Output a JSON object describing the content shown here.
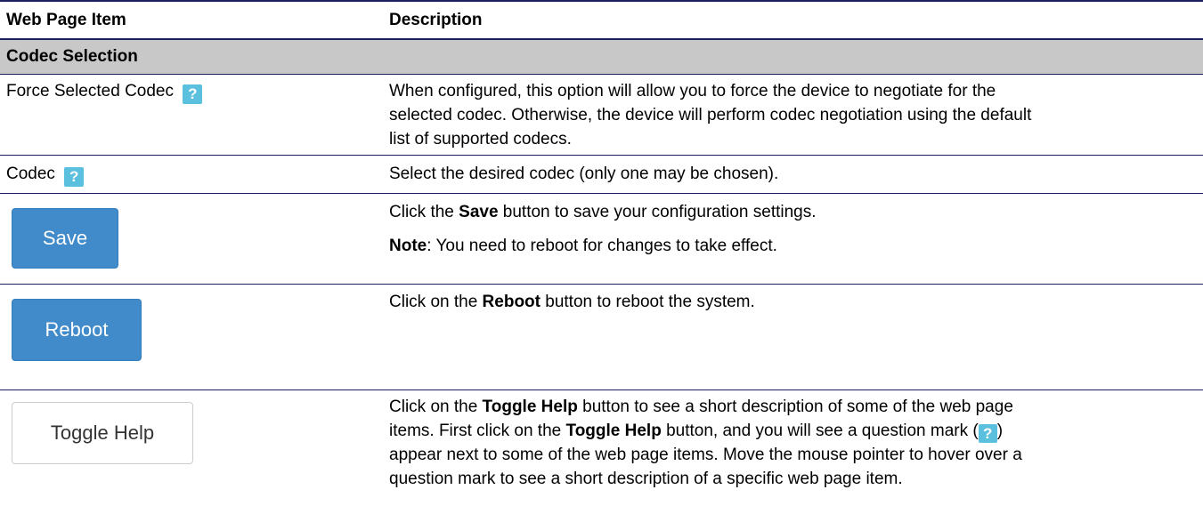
{
  "header": {
    "col1": "Web Page Item",
    "col2": "Description"
  },
  "section": {
    "title": "Codec Selection"
  },
  "help_icon_glyph": "?",
  "rows": {
    "force": {
      "label": "Force Selected Codec",
      "desc_line1": "When configured, this option will allow you to force the device to negotiate for the",
      "desc_line2": "selected codec. Otherwise, the device will perform codec negotiation using the default",
      "desc_line3": "list of supported codecs."
    },
    "codec": {
      "label": "Codec",
      "desc": "Select the desired codec (only one may be chosen)."
    },
    "save": {
      "button_label": "Save",
      "desc_pre": "Click the ",
      "desc_bold": "Save",
      "desc_post": " button to save your configuration settings.",
      "note_bold": "Note",
      "note_text": ": You need to reboot for changes to take effect."
    },
    "reboot": {
      "button_label": "Reboot",
      "desc_pre": "Click on the ",
      "desc_bold": "Reboot",
      "desc_post": " button to reboot the system."
    },
    "toggle": {
      "button_label": "Toggle Help",
      "l1_pre": "Click on the ",
      "l1_bold": "Toggle Help",
      "l1_post": " button to see a short description of some of the web page",
      "l2_pre": "items. First click on the ",
      "l2_bold": "Toggle Help",
      "l2_post": " button, and you will see a question mark (",
      "l2_end": ")",
      "l3": "appear next to some of the web page items. Move the mouse pointer to hover over a",
      "l4": "question mark to see a short description of a specific web page item."
    }
  },
  "colors": {
    "rule": "#1a1f5e",
    "section_bg": "#c8c8c8",
    "primary_button": "#428bca",
    "help_icon": "#5bc0de"
  }
}
